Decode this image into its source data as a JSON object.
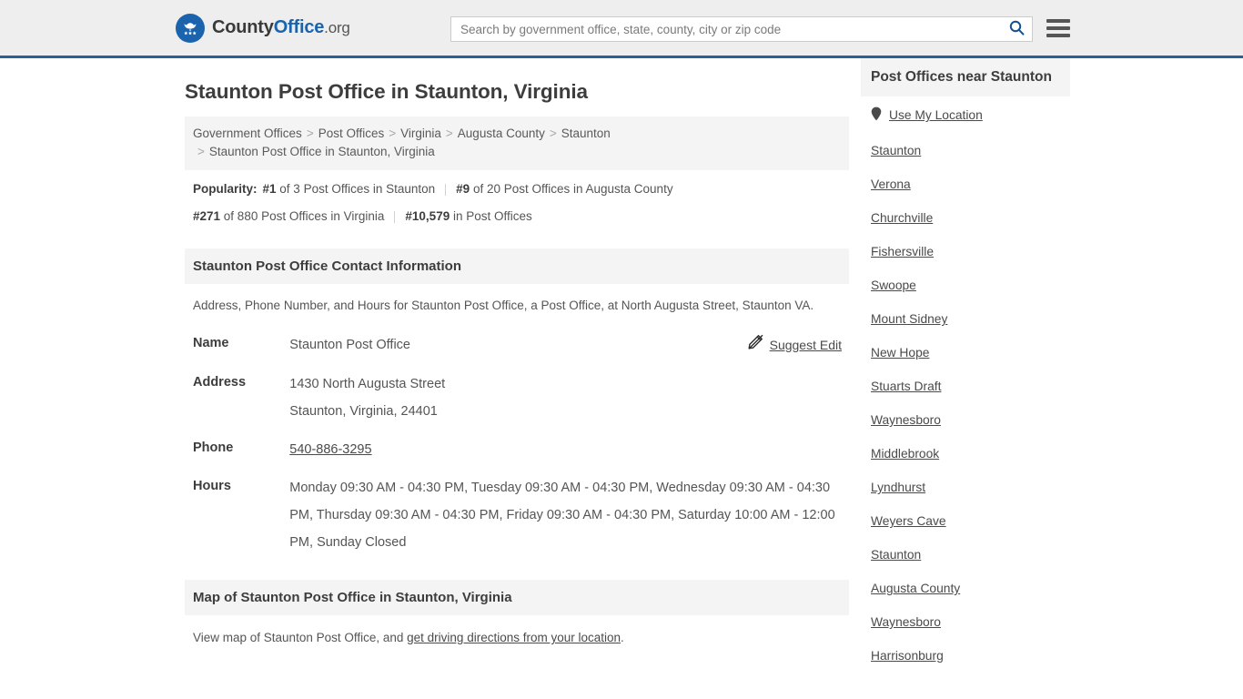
{
  "header": {
    "brand": {
      "part1": "County",
      "part2": "Office",
      "part3": ".org",
      "logo_icon": "eagle-seal-icon"
    },
    "search": {
      "placeholder": "Search by government office, state, county, city or zip code",
      "value": "",
      "search_icon": "search-icon"
    },
    "menu_icon": "hamburger-menu-icon",
    "accent_color": "#1b63ad",
    "border_color": "#2a6099",
    "background": "#eeeeee"
  },
  "page_title": "Staunton Post Office in Staunton, Virginia",
  "breadcrumb": {
    "separator": ">",
    "items": [
      {
        "label": "Government Offices",
        "link": true
      },
      {
        "label": "Post Offices",
        "link": true
      },
      {
        "label": "Virginia",
        "link": true
      },
      {
        "label": "Augusta County",
        "link": true
      },
      {
        "label": "Staunton",
        "link": true
      },
      {
        "label": "Staunton Post Office in Staunton, Virginia",
        "link": false
      }
    ]
  },
  "popularity": {
    "label": "Popularity:",
    "items": [
      {
        "rank": "#1",
        "text": " of 3 Post Offices in Staunton"
      },
      {
        "rank": "#9",
        "text": " of 20 Post Offices in Augusta County"
      },
      {
        "rank": "#271",
        "text": " of 880 Post Offices in Virginia"
      },
      {
        "rank": "#10,579",
        "text": " in Post Offices"
      }
    ]
  },
  "contact_section": {
    "heading": "Staunton Post Office Contact Information",
    "description": "Address, Phone Number, and Hours for Staunton Post Office, a Post Office, at North Augusta Street, Staunton VA.",
    "suggest_edit": {
      "label": "Suggest Edit",
      "icon": "pencil-edit-icon"
    },
    "rows": [
      {
        "label": "Name",
        "value": "Staunton Post Office",
        "link": false
      },
      {
        "label": "Address",
        "value": "1430 North Augusta Street",
        "value2": "Staunton, Virginia, 24401",
        "link": false
      },
      {
        "label": "Phone",
        "value": "540-886-3295",
        "link": true
      },
      {
        "label": "Hours",
        "value": "Monday 09:30 AM - 04:30 PM, Tuesday 09:30 AM - 04:30 PM, Wednesday 09:30 AM - 04:30 PM, Thursday 09:30 AM - 04:30 PM, Friday 09:30 AM - 04:30 PM, Saturday 10:00 AM - 12:00 PM, Sunday Closed",
        "link": false
      }
    ]
  },
  "map_section": {
    "heading": "Map of Staunton Post Office in Staunton, Virginia",
    "note_prefix": "View map of Staunton Post Office, and ",
    "note_link": "get driving directions from your location",
    "note_suffix": "."
  },
  "sidebar": {
    "heading": "Post Offices near Staunton",
    "use_my_location": {
      "label": "Use My Location",
      "icon": "map-pin-icon"
    },
    "items": [
      {
        "label": "Staunton"
      },
      {
        "label": "Verona"
      },
      {
        "label": "Churchville"
      },
      {
        "label": "Fishersville"
      },
      {
        "label": "Swoope"
      },
      {
        "label": "Mount Sidney"
      },
      {
        "label": "New Hope"
      },
      {
        "label": "Stuarts Draft"
      },
      {
        "label": "Waynesboro"
      },
      {
        "label": "Middlebrook"
      },
      {
        "label": "Lyndhurst"
      },
      {
        "label": "Weyers Cave"
      },
      {
        "label": "Staunton"
      },
      {
        "label": "Augusta County"
      },
      {
        "label": "Waynesboro"
      },
      {
        "label": "Harrisonburg"
      }
    ]
  }
}
